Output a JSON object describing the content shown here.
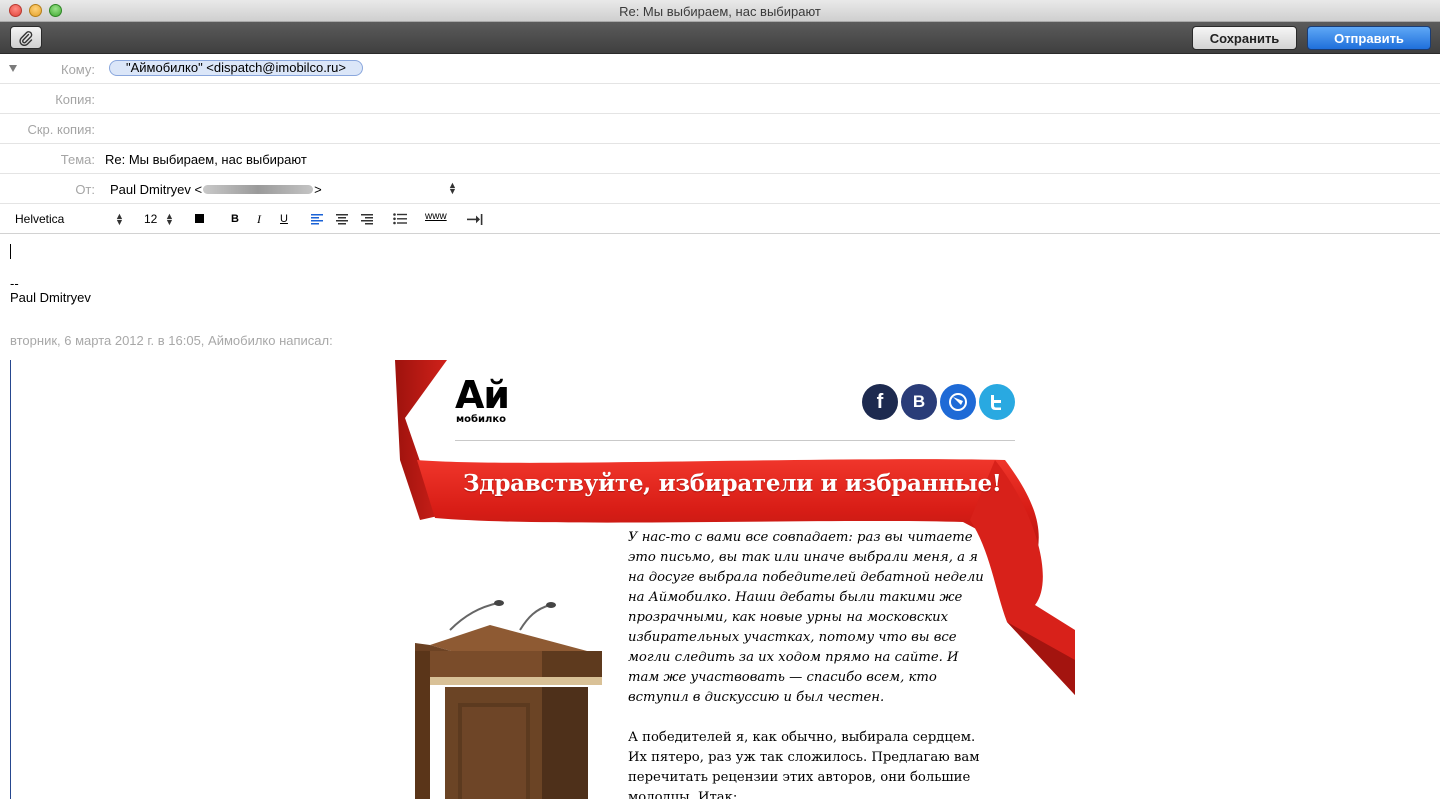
{
  "window": {
    "title": "Re: Мы выбираем, нас выбирают"
  },
  "toolbar": {
    "save_label": "Сохранить",
    "send_label": "Отправить",
    "attach_icon": "paperclip-icon"
  },
  "fields": {
    "to_label": "Кому:",
    "to_token": "\"Аймобилко\" <dispatch@imobilco.ru>",
    "cc_label": "Копия:",
    "bcc_label": "Скр. копия:",
    "subject_label": "Тема:",
    "subject_value": "Re: Мы выбираем, нас выбирают",
    "from_label": "От:",
    "from_name": "Paul Dmitryev <",
    "from_suffix": ">"
  },
  "format": {
    "font": "Helvetica",
    "size": "12",
    "bold": "B",
    "italic": "I",
    "underline": "U",
    "link": "www"
  },
  "body": {
    "sig_dash": "--",
    "signature": "Paul Dmitryev",
    "quote_header": "вторник, 6 марта 2012 г. в 16:05, Аймобилко написал:"
  },
  "newsletter": {
    "logo_main": "Ай",
    "logo_sub": "мобилко",
    "headline": "Здравствуйте, избиратели и избранные!",
    "para1": "У нас-то с вами все совпадает: раз вы читаете это письмо, вы так или иначе выбрали меня, а я на досуге выбрала победителей дебатной недели на Аймобилко. Наши дебаты были такими же прозрачными, как новые урны на московских избирательных участках, потому что вы все могли следить за их ходом прямо на сайте. И там же участвовать — спасибо всем, кто вступил в дискуссию и был честен.",
    "para2": "А победителей я, как обычно, выбирала сердцем. Их пятеро, раз уж так сложилось. Предлагаю вам перечитать рецензии этих авторов, они большие молодцы. Итак:",
    "social": [
      "f",
      "B",
      "",
      ""
    ]
  },
  "colors": {
    "send": "#2a7be4",
    "ribbon": "#e3231c",
    "quote_bar": "#26478f"
  }
}
